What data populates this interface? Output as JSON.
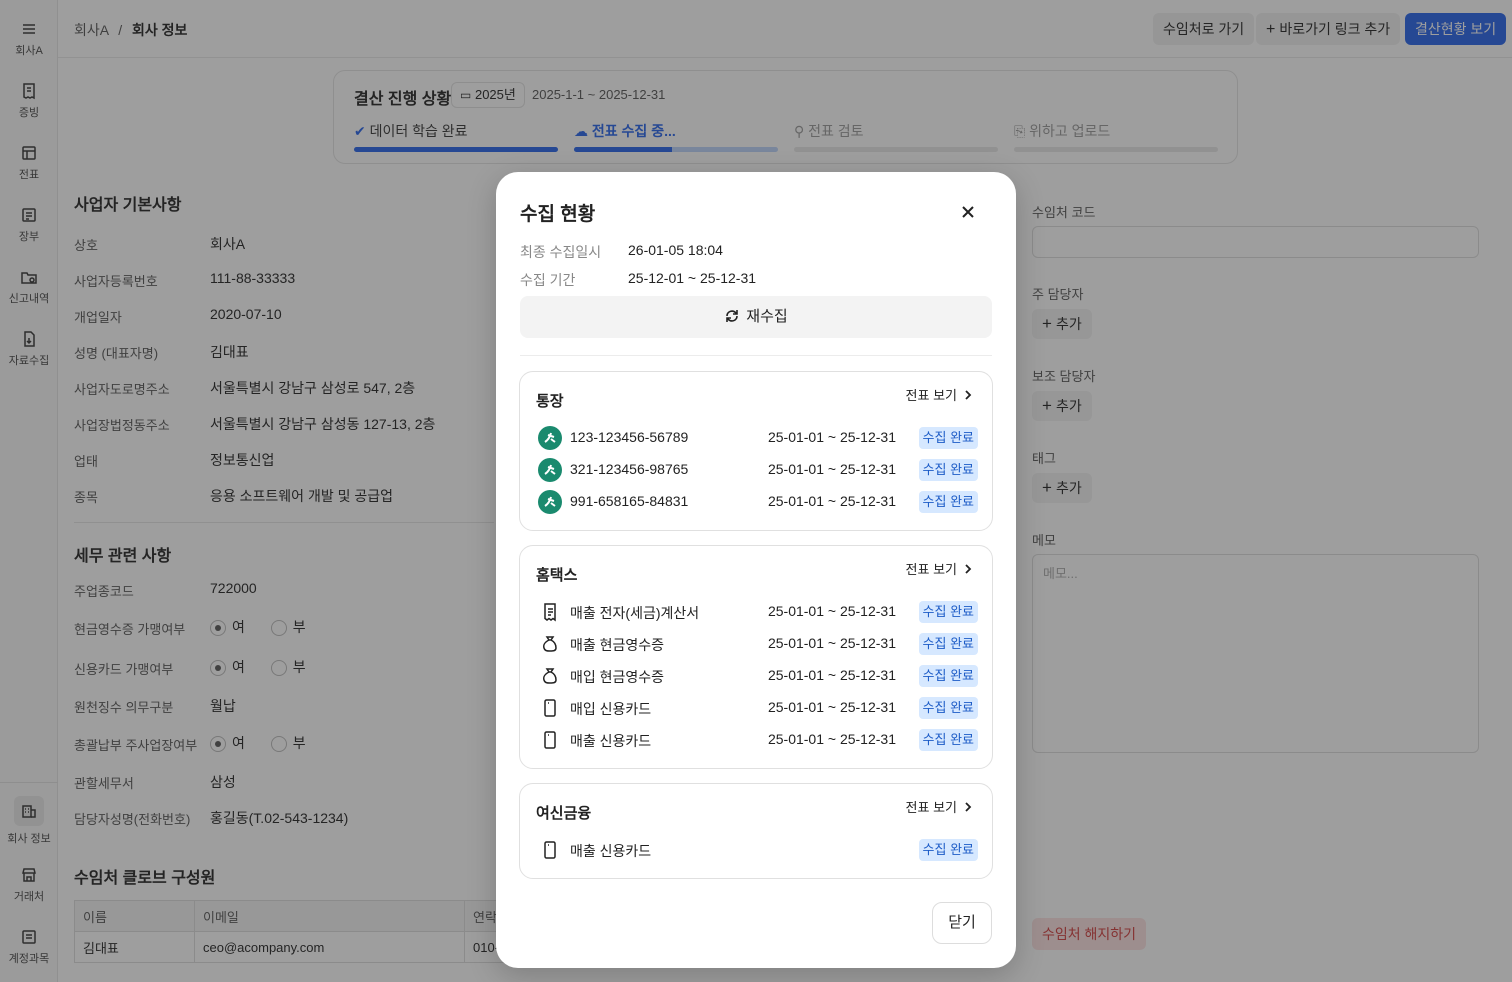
{
  "sidebar": {
    "items": [
      {
        "label": "회사A"
      },
      {
        "label": "증빙"
      },
      {
        "label": "전표"
      },
      {
        "label": "장부"
      },
      {
        "label": "신고내역"
      },
      {
        "label": "자료수집"
      }
    ],
    "bottom_items": [
      {
        "label": "회사 정보"
      },
      {
        "label": "거래처"
      },
      {
        "label": "계정과목"
      }
    ]
  },
  "header": {
    "breadcrumb_root": "회사A",
    "breadcrumb_sep": "/",
    "breadcrumb_current": "회사 정보",
    "btn_goto": "수임처로 가기",
    "btn_add_link": "바로가기 링크 추가",
    "btn_view_status": "결산현황 보기"
  },
  "progress": {
    "title": "결산 진행 상황",
    "year": "2025년",
    "range": "2025-1-1 ~ 2025-12-31",
    "steps": [
      {
        "label": "데이터 학습 완료",
        "progress": 1.0
      },
      {
        "label": "전표 수집 중...",
        "progress": 0.48
      },
      {
        "label": "전표 검토",
        "progress": 0
      },
      {
        "label": "위하고 업로드",
        "progress": 0
      }
    ]
  },
  "business": {
    "title": "사업자 기본사항",
    "rows": [
      {
        "k": "상호",
        "v": "회사A"
      },
      {
        "k": "사업자등록번호",
        "v": "111-88-33333"
      },
      {
        "k": "개업일자",
        "v": "2020-07-10"
      },
      {
        "k": "성명 (대표자명)",
        "v": "김대표"
      },
      {
        "k": "사업자도로명주소",
        "v": "서울특별시 강남구 삼성로 547, 2층"
      },
      {
        "k": "사업장법정동주소",
        "v": "서울특별시 강남구 삼성동 127-13, 2층"
      },
      {
        "k": "업태",
        "v": "정보통신업"
      },
      {
        "k": "종목",
        "v": "응용 소프트웨어 개발 및 공급업"
      }
    ]
  },
  "tax": {
    "title": "세무 관련 사항",
    "industry_code_k": "주업종코드",
    "industry_code_v": "722000",
    "cash_receipt_k": "현금영수증 가맹여부",
    "card_k": "신용카드 가맹여부",
    "withholding_k": "원천징수 의무구분",
    "withholding_v": "월납",
    "consolidated_k": "총괄납부 주사업장여부",
    "office_k": "관할세무서",
    "office_v": "삼성",
    "manager_k": "담당자성명(전화번호)",
    "manager_v": "홍길동(T.02-543-1234)",
    "yes": "여",
    "no": "부"
  },
  "members": {
    "title": "수임처 클로브 구성원",
    "headers": [
      "이름",
      "이메일",
      "연락"
    ],
    "rows": [
      [
        "김대표",
        "ceo@acompany.com",
        "010-"
      ]
    ]
  },
  "right": {
    "code_label": "수임처 코드",
    "main_manager_label": "주 담당자",
    "sub_manager_label": "보조 담당자",
    "tag_label": "태그",
    "memo_label": "메모",
    "memo_placeholder": "메모...",
    "add": "추가",
    "cancel_btn": "수임처 해지하기"
  },
  "modal": {
    "title": "수집 현황",
    "last_collected_k": "최종 수집일시",
    "last_collected_v": "26-01-05 18:04",
    "period_k": "수집 기간",
    "period_v": "25-12-01 ~ 25-12-31",
    "recollect": "재수집",
    "view_slip": "전표 보기",
    "close": "닫기",
    "sections": [
      {
        "title": "통장",
        "rows": [
          {
            "name": "123-123456-56789",
            "range": "25-01-01 ~ 25-12-31",
            "status": "수집 완료",
            "icon": "bank-logo-icon"
          },
          {
            "name": "321-123456-98765",
            "range": "25-01-01 ~ 25-12-31",
            "status": "수집 완료",
            "icon": "bank-logo-icon"
          },
          {
            "name": "991-658165-84831",
            "range": "25-01-01 ~ 25-12-31",
            "status": "수집 완료",
            "icon": "bank-logo-icon"
          }
        ]
      },
      {
        "title": "홈택스",
        "rows": [
          {
            "name": "매출 전자(세금)계산서",
            "range": "25-01-01 ~ 25-12-31",
            "status": "수집 완료",
            "icon": "invoice-icon"
          },
          {
            "name": "매출 현금영수증",
            "range": "25-01-01 ~ 25-12-31",
            "status": "수집 완료",
            "icon": "money-bag-icon"
          },
          {
            "name": "매입 현금영수증",
            "range": "25-01-01 ~ 25-12-31",
            "status": "수집 완료",
            "icon": "money-bag-icon"
          },
          {
            "name": "매입 신용카드",
            "range": "25-01-01 ~ 25-12-31",
            "status": "수집 완료",
            "icon": "card-icon"
          },
          {
            "name": "매출 신용카드",
            "range": "25-01-01 ~ 25-12-31",
            "status": "수집 완료",
            "icon": "card-icon"
          }
        ]
      },
      {
        "title": "여신금융",
        "rows": [
          {
            "name": "매출 신용카드",
            "range": "",
            "status": "수집 완료",
            "icon": "card-icon"
          }
        ]
      }
    ]
  }
}
